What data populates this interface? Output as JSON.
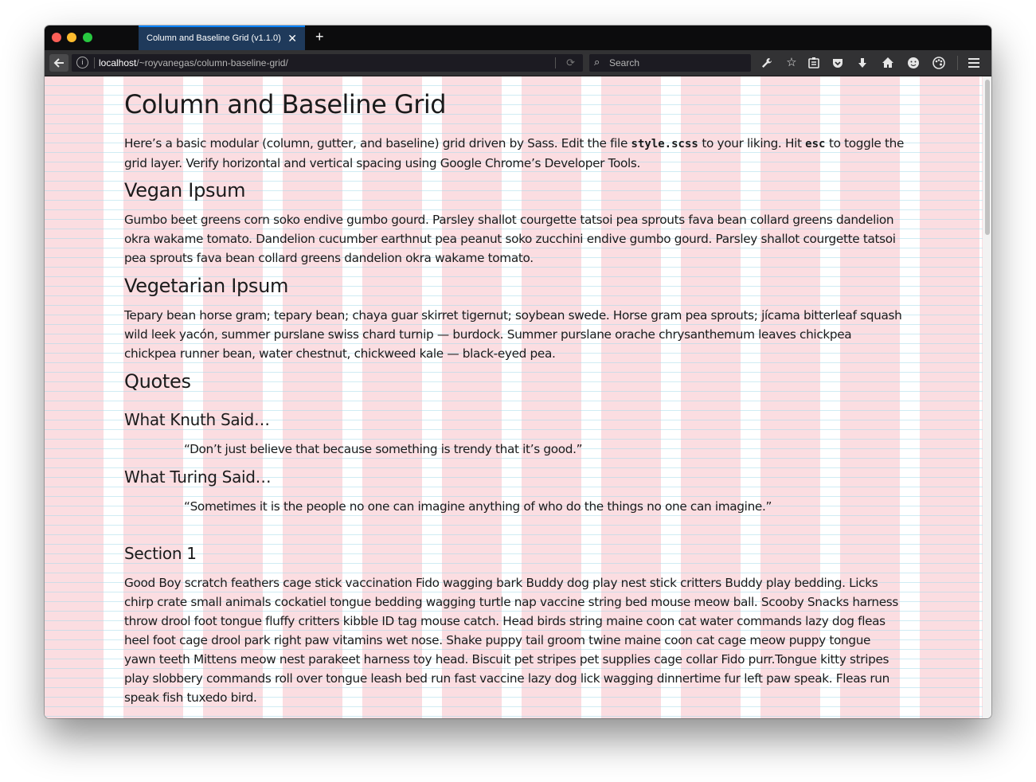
{
  "browser": {
    "tab_title": "Column and Baseline Grid (v1.1.0)",
    "tab_close": "✕",
    "new_tab": "+",
    "url_host": "localhost",
    "url_path": "/~royvanegas/column-baseline-grid/",
    "search_placeholder": "Search",
    "icons": [
      "back-icon",
      "info-icon",
      "reload-icon",
      "search-icon",
      "wrench-icon",
      "star-icon",
      "reader-icon",
      "pocket-icon",
      "download-icon",
      "home-icon",
      "emoji-icon",
      "palette-icon",
      "hamburger-menu-icon"
    ]
  },
  "page": {
    "title": "Column and Baseline Grid",
    "intro": {
      "part1": "Here’s a basic modular (column, gutter, and baseline) grid driven by Sass. Edit the file ",
      "code1": "style.scss",
      "part2": " to your liking. Hit ",
      "code2": "esc",
      "part3": " to toggle the grid layer. Verify horizontal and vertical spacing using Google Chrome’s Developer Tools."
    },
    "vegan_heading": "Vegan Ipsum",
    "vegan_text": "Gumbo beet greens corn soko endive gumbo gourd. Parsley shallot courgette tatsoi pea sprouts fava bean collard greens dandelion okra wakame tomato. Dandelion cucumber earthnut pea peanut soko zucchini endive gumbo gourd. Parsley shallot courgette tatsoi pea sprouts fava bean collard greens dandelion okra wakame tomato.",
    "vegetarian_heading": "Vegetarian Ipsum",
    "vegetarian_text": "Tepary bean horse gram; tepary bean; chaya guar skirret tigernut; soybean swede. Horse gram pea sprouts; jícama bitterleaf squash wild leek yacón, summer purslane swiss chard turnip — burdock. Summer purslane orache chrysanthemum leaves chickpea chickpea runner bean, water chestnut, chickweed kale — black-eyed pea.",
    "quotes_heading": "Quotes",
    "knuth_heading": "What Knuth Said…",
    "knuth_quote": "“Don’t just believe that because something is trendy that it’s good.”",
    "turing_heading": "What Turing Said…",
    "turing_quote": "“Sometimes it is the people no one can imagine anything of who do the things no one can imagine.”",
    "section1_heading": "Section 1",
    "section1_text": "Good Boy scratch feathers cage stick vaccination Fido wagging bark Buddy dog play nest stick critters Buddy play bedding. Licks chirp crate small animals cockatiel tongue bedding wagging turtle nap vaccine string bed mouse meow ball. Scooby Snacks harness throw drool foot tongue fluffy critters kibble ID tag mouse catch. Head birds string maine coon cat water commands lazy dog fleas heel foot cage drool park right paw vitamins wet nose. Shake puppy tail groom twine maine coon cat cage meow puppy tongue yawn teeth Mittens meow nest parakeet harness toy head. Biscuit pet stripes pet supplies cage collar Fido purr.Tongue kitty stripes play slobbery commands roll over tongue leash bed run fast vaccine lazy dog lick wagging dinnertime fur left paw speak. Fleas run speak fish tuxedo bird."
  },
  "colors": {
    "grid_column": "#fbdde1",
    "grid_baseline": "#aadceb",
    "tab_active": "#1f3a5b",
    "chrome_dark": "#0c0c0d"
  }
}
